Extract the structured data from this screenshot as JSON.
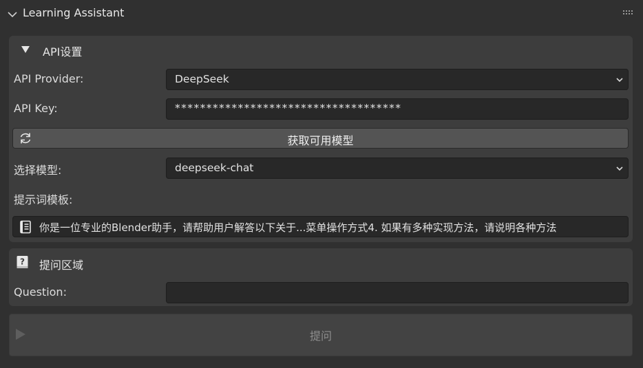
{
  "panel": {
    "title": "Learning Assistant"
  },
  "api_section": {
    "title": "API设置",
    "provider_label": "API Provider:",
    "provider_value": "DeepSeek",
    "key_label": "API Key:",
    "key_value": "************************************",
    "fetch_button": "获取可用模型",
    "model_label": "选择模型:",
    "model_value": "deepseek-chat",
    "template_label": "提示词模板:",
    "template_value": "你是一位专业的Blender助手，请帮助用户解答以下关于...菜单操作方式4. 如果有多种实现方法，请说明各种方法"
  },
  "question_section": {
    "title": "提问区域",
    "question_label": "Question:",
    "question_value": "",
    "ask_button": "提问"
  },
  "icons": [
    "chevron-down-icon",
    "drag-grip-icon",
    "triangle-down-icon",
    "dropdown-arrow-icon",
    "refresh-icon",
    "text-document-icon",
    "help-book-icon",
    "play-icon"
  ],
  "colors": {
    "background": "#303030",
    "panel": "#3d3d3d",
    "field": "#282828",
    "button": "#545454",
    "disabled_button": "#434343",
    "text": "#e6e6e6"
  }
}
